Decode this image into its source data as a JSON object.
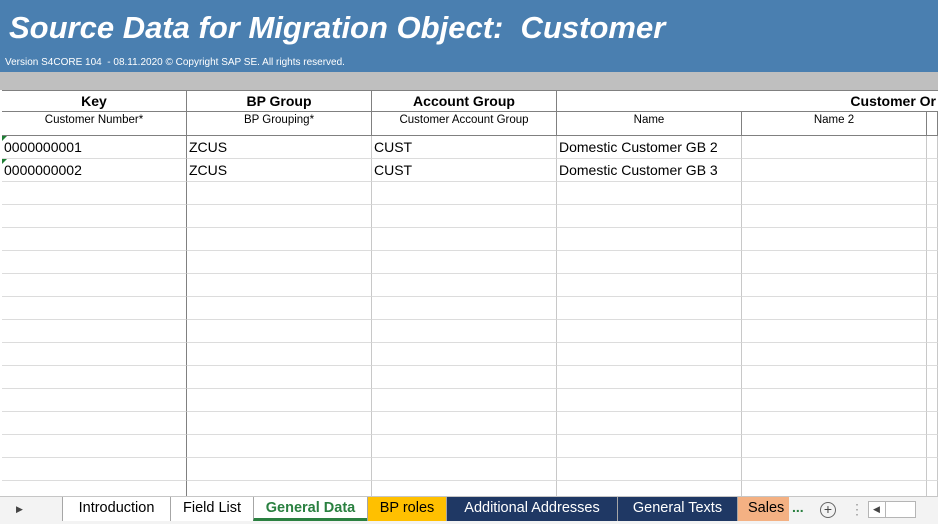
{
  "banner": {
    "title": "Source Data for Migration Object:  Customer",
    "version": "Version S4CORE 104  - 08.11.2020 © Copyright SAP SE. All rights reserved."
  },
  "columns": [
    {
      "group": "Key",
      "field": "Customer Number*"
    },
    {
      "group": "BP Group",
      "field": "BP Grouping*"
    },
    {
      "group": "Account Group",
      "field": "Customer Account Group"
    },
    {
      "group": "Customer Or",
      "field": "Name"
    },
    {
      "group": "",
      "field": "Name 2"
    }
  ],
  "rows": [
    [
      "0000000001",
      "ZCUS",
      "CUST",
      "Domestic Customer GB 2",
      ""
    ],
    [
      "0000000002",
      "ZCUS",
      "CUST",
      "Domestic Customer GB 3",
      ""
    ]
  ],
  "sheet_tabs": [
    {
      "label": "Introduction",
      "active": false
    },
    {
      "label": "Field List",
      "active": false
    },
    {
      "label": "General Data",
      "active": true
    },
    {
      "label": "BP roles",
      "active": false
    },
    {
      "label": "Additional Addresses",
      "active": false
    },
    {
      "label": "General Texts",
      "active": false
    },
    {
      "label": "Sales I",
      "active": false
    }
  ],
  "more_tabs_indicator": "...",
  "add_sheet_symbol": "+",
  "colors": {
    "banner": "#4a7fb0",
    "active_tab_text": "#2a8040",
    "bp_roles_tab": "#ffc000",
    "navy_tabs": "#1f3864",
    "sales_tab": "#f4b183"
  }
}
